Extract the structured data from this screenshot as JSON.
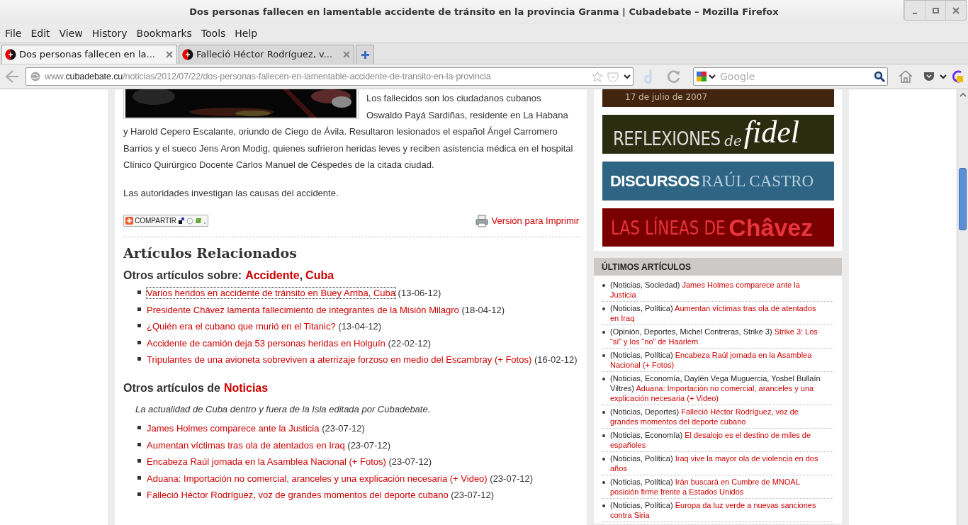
{
  "window": {
    "title": "Dos personas fallecen en lamentable accidente de tránsito en la provincia Granma | Cubadebate – Mozilla Firefox"
  },
  "menu": [
    "File",
    "Edit",
    "View",
    "History",
    "Bookmarks",
    "Tools",
    "Help"
  ],
  "tabs": [
    {
      "label": "Dos personas fallecen en la...",
      "selected": true
    },
    {
      "label": "Falleció Héctor Rodríguez, v...",
      "selected": false
    }
  ],
  "address": {
    "prefix": "www.",
    "host": "cubadebate.cu",
    "path": "/noticias/2012/07/22/dos-personas-fallecen-en-lamentable-accidente-de-transito-en-la-provincia"
  },
  "search": {
    "placeholder": "Google"
  },
  "article": {
    "beside_image": "Los fallecidos son los ciudadanos cubanos Oswaldo Payá Sardiñas, residente en La Habana",
    "paragraphs": [
      "y Harold Cepero Escalante, oriundo de Ciego de Ávila. Resultaron lesionados el español Ángel Carromero Barrios y el sueco Jens Aron Modig, quienes sufrieron heridas leves y reciben asistencia médica en el hospital Clínico Quirúrgico Docente Carlos Manuel de Céspedes de la citada ciudad.",
      "Las autoridades investigan las causas del accidente."
    ],
    "share": "COMPARTIR",
    "print": "Versión para Imprimir"
  },
  "related": {
    "heading": "Artículos Relacionados",
    "tags_label": "Otros artículos sobre:",
    "tags": [
      "Accidente",
      "Cuba"
    ],
    "tags_separator": ",",
    "tag_items": [
      {
        "title": "Varios heridos en accidente de tránsito en Buey Arriba, Cuba",
        "date": "(13-06-12)",
        "focused": true
      },
      {
        "title": "Presidente Chávez lamenta fallecimiento de integrantes de la Misión Milagro",
        "date": "(18-04-12)",
        "focused": false
      },
      {
        "title": "¿Quién era el cubano que murió en el Titanic?",
        "date": "(13-04-12)",
        "focused": false
      },
      {
        "title": "Accidente de camión deja 53 personas heridas en Holguín",
        "date": "(22-02-12)",
        "focused": false
      },
      {
        "title": "Tripulantes de una avioneta sobreviven a aterrizaje forzoso en medio del Escambray (+ Fotos)",
        "date": "(16-02-12)",
        "focused": false
      }
    ],
    "category_label": "Otros artículos de",
    "category": "Noticias",
    "category_description": "La actualidad de Cuba dentro y fuera de la Isla editada por Cubadebate.",
    "category_items": [
      {
        "title": "James Holmes comparece ante la Justicia",
        "date": "(23-07-12)",
        "focused": false
      },
      {
        "title": "Aumentan víctimas tras ola de atentados en Iraq",
        "date": "(23-07-12)",
        "focused": false
      },
      {
        "title": "Encabeza Raúl jornada en la Asamblea Nacional (+ Fotos)",
        "date": "(23-07-12)",
        "focused": false
      },
      {
        "title": "Aduana: Importación no comercial, aranceles y una explicación necesaria (+ Video)",
        "date": "(23-07-12)",
        "focused": false
      },
      {
        "title": "Falleció Héctor Rodríguez, voz de grandes momentos del deporte cubano",
        "date": "(23-07-12)",
        "focused": false
      }
    ]
  },
  "sidebar": {
    "banners": [
      {
        "kind": "date",
        "text": "17 de julio de 2007"
      },
      {
        "kind": "reflexiones",
        "text": "REFLEXIONES",
        "small": "de",
        "big": "fidel"
      },
      {
        "kind": "discursos",
        "text": "DISCURSOS",
        "big": "RAÚL CASTRO"
      },
      {
        "kind": "lineas",
        "text": "LAS LÍNEAS DE",
        "big": "Châvez"
      }
    ],
    "latest": {
      "heading": "ÚLTIMOS ARTÍCULOS",
      "items": [
        {
          "categories": "(Noticias, Sociedad)",
          "title": "James Holmes comparece ante la Justicia"
        },
        {
          "categories": "(Noticias, Política)",
          "title": "Aumentan víctimas tras ola de atentados en Iraq"
        },
        {
          "categories": "(Opinión, Deportes, Michel Contreras, Strike 3)",
          "title": "Strike 3: Los “sí” y los “no” de Haarlem"
        },
        {
          "categories": "(Noticias, Política)",
          "title": "Encabeza Raúl jornada en la Asamblea Nacional (+ Fotos)"
        },
        {
          "categories": "(Noticias, Economía, Daylén Vega Muguercia, Yosbel Bullaín Viltres)",
          "title": "Aduana: Importación no comercial, aranceles y una explicación necesaria (+ Video)"
        },
        {
          "categories": "(Noticias, Deportes)",
          "title": "Falleció Héctor Rodríguez, voz de grandes momentos del deporte cubano"
        },
        {
          "categories": "(Noticias, Economía)",
          "title": "El desalojo es el destino de miles de españoles"
        },
        {
          "categories": "(Noticias, Política)",
          "title": "Iraq vive la mayor ola de violencia en dos años"
        },
        {
          "categories": "(Noticias, Política)",
          "title": "Irán buscará en Cumbre de MNOAL posición firme frente a Estados Unidos"
        },
        {
          "categories": "(Noticias, Política)",
          "title": "Europa da luz verde a nuevas sanciones contra Siria"
        }
      ]
    }
  }
}
